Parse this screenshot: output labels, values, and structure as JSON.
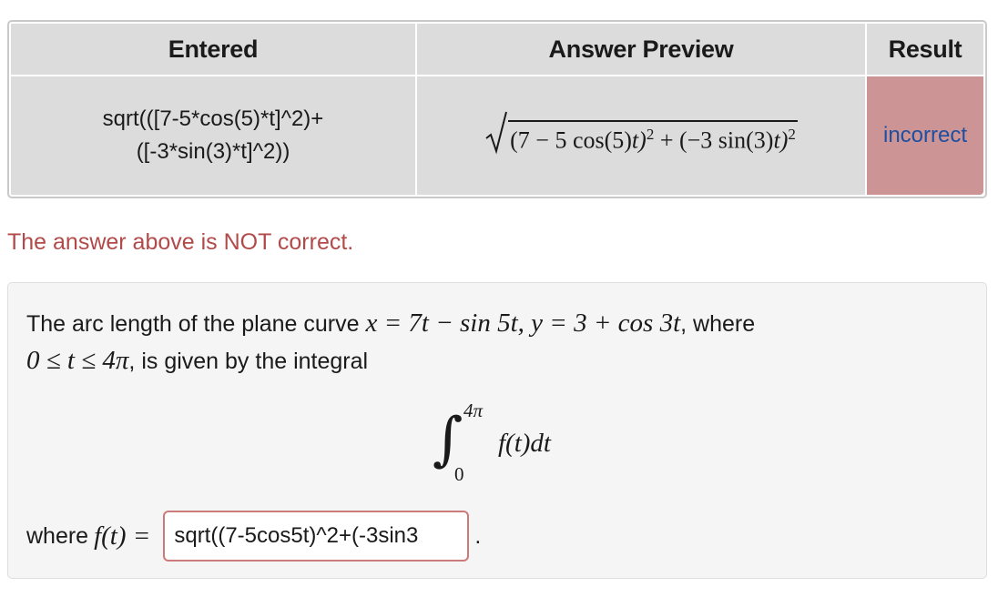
{
  "results_table": {
    "headers": {
      "entered": "Entered",
      "preview": "Answer Preview",
      "result": "Result"
    },
    "row": {
      "entered_line1": "sqrt(([7-5*cos(5)*t]^2)+",
      "entered_line2": "([-3*sin(3)*t]^2))",
      "preview_latex": "(7 − 5 cos(5)t)² + (−3 sin(3)t)²",
      "preview_part1": "(7 − 5 cos(5)",
      "preview_part2": "t)",
      "preview_part3": " + (−3 sin(3)",
      "preview_part4": "t)",
      "exponent": "2",
      "result": "incorrect"
    }
  },
  "feedback": {
    "message": "The answer above is NOT correct."
  },
  "problem": {
    "text_a": "The arc length of the plane curve ",
    "eq_x": "x = 7t − sin 5t, y = 3 + cos 3t",
    "text_b": ", where",
    "range": "0 ≤ t ≤ 4π",
    "text_c": ", is given by the integral",
    "integral": {
      "upper": "4π",
      "lower": "0",
      "integrand": "f(t)dt"
    },
    "where_label": "where ",
    "f_of_t": "f(t) =",
    "answer_value": "sqrt((7-5cos5t)^2+(-3sin3",
    "period": "."
  },
  "colors": {
    "incorrect_bg": "#cc9494",
    "incorrect_text": "#1f4fa0",
    "feedback_red": "#b24a4a",
    "input_border": "#cc7a7a"
  }
}
